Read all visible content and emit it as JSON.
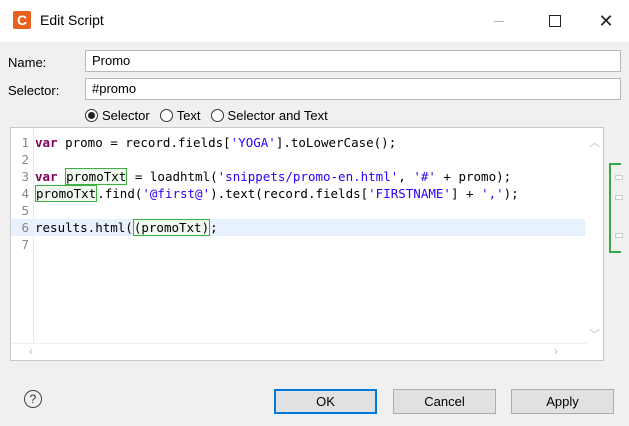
{
  "window": {
    "app_icon_letter": "C",
    "title": "Edit Script",
    "minimize_icon": "minimize-icon",
    "maximize_icon": "maximize-icon",
    "close_icon": "close-icon",
    "close_glyph": "✕"
  },
  "form": {
    "name_label": "Name:",
    "name_value": "Promo",
    "selector_label": "Selector:",
    "selector_value": "#promo"
  },
  "mode": {
    "options": [
      "Selector",
      "Text",
      "Selector and Text"
    ],
    "selected": "Selector"
  },
  "editor": {
    "lines": [
      {
        "num": "1",
        "parts": [
          {
            "t": "var",
            "c": "kw"
          },
          {
            "t": " promo = record.fields["
          },
          {
            "t": "'YOGA'",
            "c": "str"
          },
          {
            "t": "].toLowerCase();"
          }
        ]
      },
      {
        "num": "2",
        "parts": []
      },
      {
        "num": "3",
        "parts": [
          {
            "t": "var",
            "c": "kw"
          },
          {
            "t": " "
          },
          {
            "t": "promoTxt",
            "c": "hl"
          },
          {
            "t": " = loadhtml("
          },
          {
            "t": "'snippets/promo-en.html'",
            "c": "str"
          },
          {
            "t": ", "
          },
          {
            "t": "'#'",
            "c": "str"
          },
          {
            "t": " + promo);"
          }
        ]
      },
      {
        "num": "4",
        "parts": [
          {
            "t": "promoTxt",
            "c": "hl"
          },
          {
            "t": ".find("
          },
          {
            "t": "'@first@'",
            "c": "str"
          },
          {
            "t": ").text(record.fields["
          },
          {
            "t": "'FIRSTNAME'",
            "c": "str"
          },
          {
            "t": "] + "
          },
          {
            "t": "','",
            "c": "str"
          },
          {
            "t": ");"
          }
        ]
      },
      {
        "num": "5",
        "parts": []
      },
      {
        "num": "6",
        "parts": [
          {
            "t": "results.html("
          },
          {
            "t": "(promoTxt)",
            "c": "hl"
          },
          {
            "t": ";"
          }
        ],
        "current": true
      },
      {
        "num": "7",
        "parts": []
      }
    ],
    "current_line": 6
  },
  "buttons": {
    "help_glyph": "?",
    "ok": "OK",
    "cancel": "Cancel",
    "apply": "Apply"
  },
  "colors": {
    "app_icon": "#e8601e",
    "keyword": "#7f0055",
    "string": "#2a00ff",
    "highlight_border": "#3cb043",
    "default_button_border": "#0078d7"
  }
}
